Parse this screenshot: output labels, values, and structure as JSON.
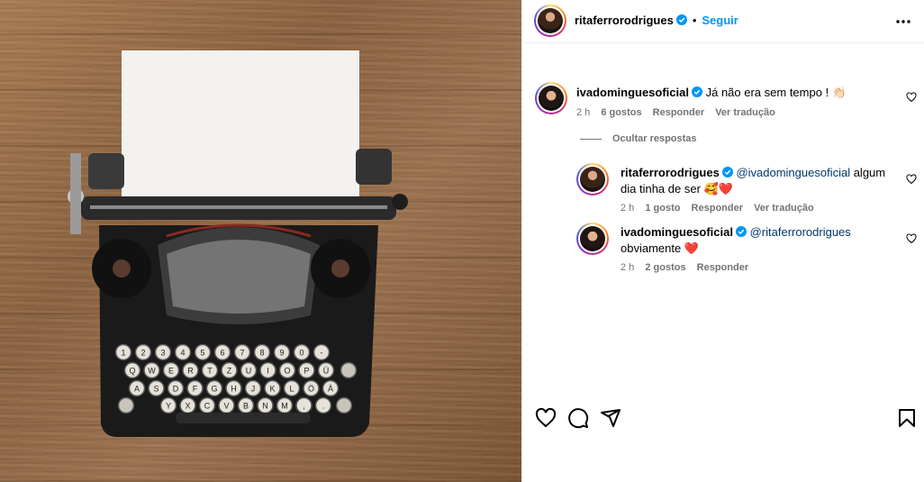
{
  "header": {
    "username": "ritaferrorodrigues",
    "separator": "•",
    "follow_label": "Seguir"
  },
  "comment": {
    "username": "ivadominguesoficial",
    "text": "Já não era sem tempo !",
    "emoji": "👏🏻",
    "time": "2 h",
    "likes": "6 gostos",
    "reply": "Responder",
    "translate": "Ver tradução"
  },
  "hide_replies": "Ocultar respostas",
  "replies": [
    {
      "username": "ritaferrorodrigues",
      "mention": "@ivadominguesoficial",
      "text_after_mention": " algum",
      "line2": "dia tinha de ser 🥰❤️",
      "time": "2 h",
      "likes": "1 gosto",
      "reply": "Responder",
      "translate": "Ver tradução"
    },
    {
      "username": "ivadominguesoficial",
      "mention": "@ritaferrorodrigues",
      "line2": "obviamente ❤️",
      "time": "2 h",
      "likes": "2 gostos",
      "reply": "Responder"
    }
  ],
  "keyboard": {
    "row1": [
      "1",
      "2",
      "3",
      "4",
      "5",
      "6",
      "7",
      "8",
      "9",
      "0",
      "-"
    ],
    "row2": [
      "Q",
      "W",
      "E",
      "R",
      "T",
      "Z",
      "U",
      "I",
      "O",
      "P",
      "Ü"
    ],
    "row3": [
      "A",
      "S",
      "D",
      "F",
      "G",
      "H",
      "J",
      "K",
      "L",
      "Ö",
      "Ä"
    ],
    "row4": [
      "Y",
      "X",
      "C",
      "V",
      "B",
      "N",
      "M",
      ",",
      "."
    ]
  },
  "icons": {
    "verified": "verified-badge-icon",
    "more": "more-options-icon",
    "like": "heart-icon",
    "comment": "comment-icon",
    "share": "share-icon",
    "save": "bookmark-icon"
  },
  "colors": {
    "link_blue": "#0095f6",
    "mention": "#00376b",
    "muted": "#737373",
    "verified": "#0095f6"
  }
}
